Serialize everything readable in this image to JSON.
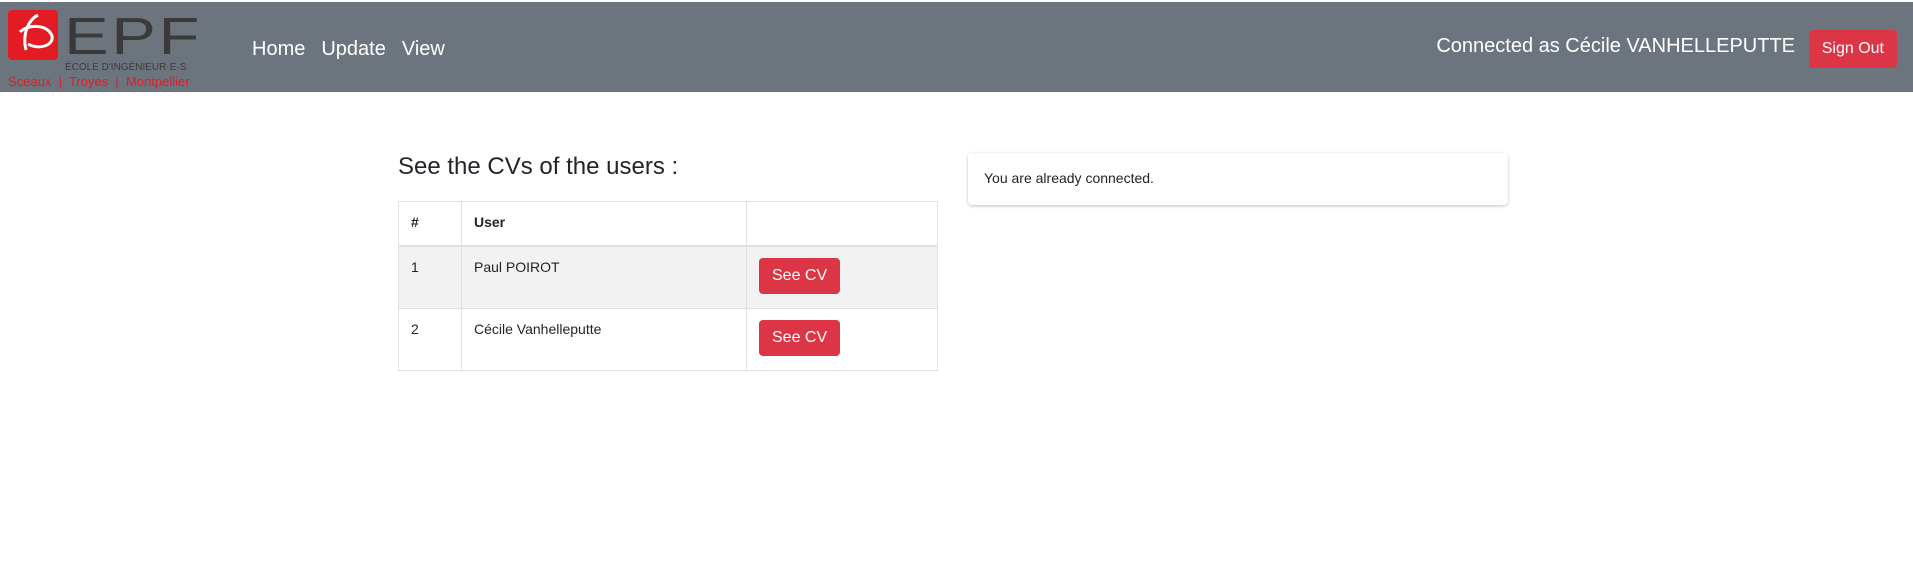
{
  "header": {
    "logo": {
      "brand": "EPF",
      "tagline": "ÉCOLE D'INGÉNIEUR·E·S",
      "campuses": "Sceaux  |  Troyes  |  Montpellier",
      "brand_color": "#e31b23"
    },
    "nav": [
      {
        "label": "Home"
      },
      {
        "label": "Update"
      },
      {
        "label": "View"
      }
    ],
    "connected_text": "Connected as Cécile VANHELLEPUTTE",
    "signout_label": "Sign Out",
    "bg_color": "#6c757d"
  },
  "main": {
    "title": "See the CVs of the users :",
    "table": {
      "headers": [
        "#",
        "User",
        ""
      ],
      "rows": [
        {
          "num": "1",
          "user": "Paul POIROT",
          "action": "See CV"
        },
        {
          "num": "2",
          "user": "Cécile Vanhelleputte",
          "action": "See CV"
        }
      ]
    }
  },
  "alert": {
    "message": "You are already connected."
  },
  "accent_color": "#dc3545"
}
